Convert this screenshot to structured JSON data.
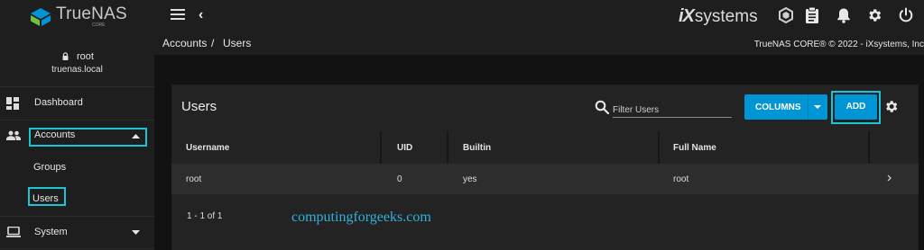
{
  "brand": {
    "name": "TrueNAS",
    "sub": "CORE"
  },
  "vendor": {
    "mark": "iX",
    "word": "systems"
  },
  "topbar_icons": [
    "menu-icon",
    "back-icon",
    "truecommand-icon",
    "clipboard-icon",
    "bell-icon",
    "gear-icon",
    "power-icon"
  ],
  "user": {
    "name": "root",
    "host": "truenas.local"
  },
  "sidebar": {
    "items": [
      {
        "label": "Dashboard",
        "icon": "dashboard-icon"
      },
      {
        "label": "Accounts",
        "icon": "people-icon"
      },
      {
        "label": "Groups"
      },
      {
        "label": "Users"
      },
      {
        "label": "System",
        "icon": "laptop-icon"
      }
    ]
  },
  "breadcrumb": {
    "parent": "Accounts",
    "separator": "/",
    "current": "Users"
  },
  "copyright": "TrueNAS CORE® © 2022 - iXsystems, Inc",
  "card": {
    "title": "Users",
    "filter_placeholder": "Filter Users",
    "columns_button": "COLUMNS",
    "add_button": "ADD"
  },
  "table": {
    "headers": [
      "Username",
      "UID",
      "Builtin",
      "Full Name"
    ],
    "rows": [
      {
        "username": "root",
        "uid": "0",
        "builtin": "yes",
        "full_name": "root"
      }
    ],
    "pager": "1 - 1 of 1"
  },
  "watermark": "computingforgeeks.com",
  "colors": {
    "accent": "#0095d5",
    "highlight": "#1ec3d8",
    "topbar": "#1e1e1e",
    "background": "#121212"
  }
}
